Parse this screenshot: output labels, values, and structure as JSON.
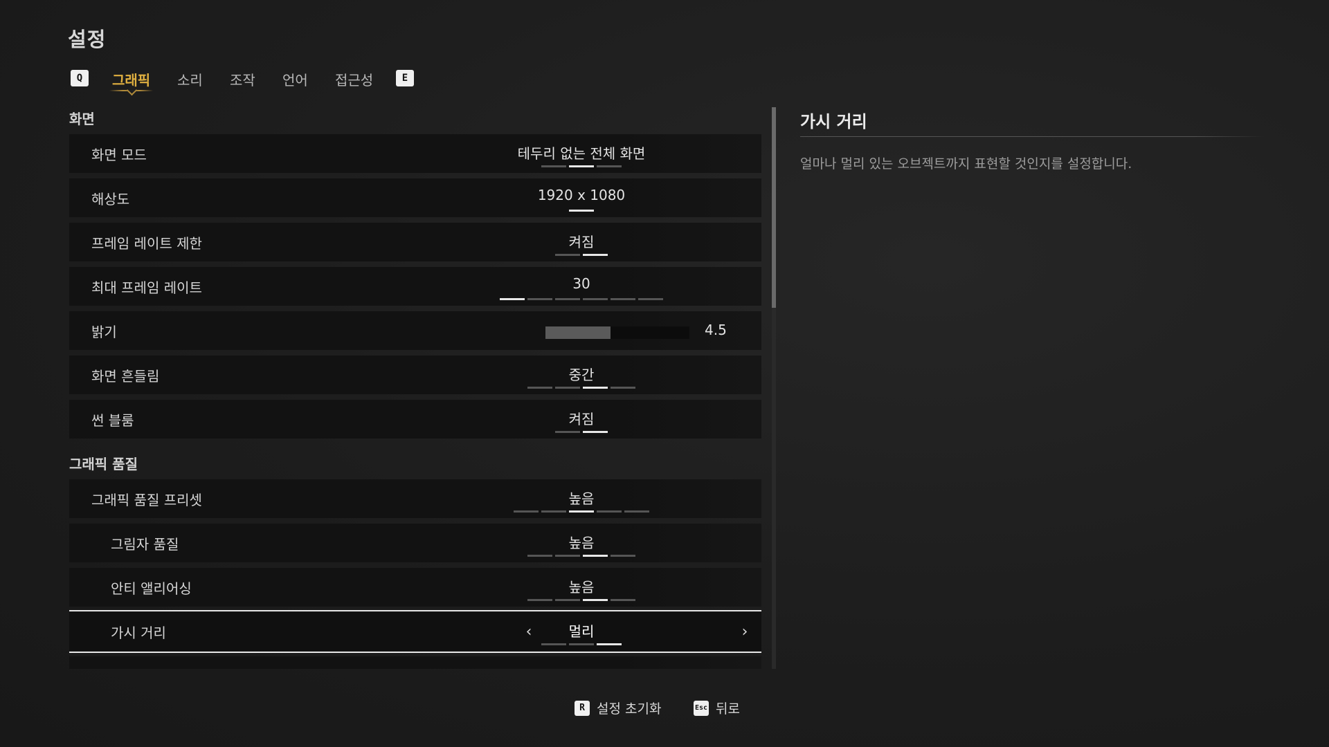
{
  "page": {
    "title": "설정"
  },
  "tabs": {
    "prev_key": "Q",
    "next_key": "E",
    "items": [
      {
        "label": "그래픽",
        "active": true
      },
      {
        "label": "소리"
      },
      {
        "label": "조작"
      },
      {
        "label": "언어"
      },
      {
        "label": "접근성"
      }
    ]
  },
  "sections": {
    "display": "화면",
    "graphics_quality": "그래픽 품질"
  },
  "rows": {
    "display_mode": {
      "label": "화면 모드",
      "value": "테두리 없는 전체 화면",
      "option_count": 3,
      "selected_index": 1
    },
    "resolution": {
      "label": "해상도",
      "value": "1920 x 1080",
      "option_count": 1,
      "selected_index": 0
    },
    "frame_limit": {
      "label": "프레임 레이트 제한",
      "value": "켜짐",
      "option_count": 2,
      "selected_index": 1
    },
    "max_fps": {
      "label": "최대 프레임 레이트",
      "value": "30",
      "option_count": 6,
      "selected_index": 0
    },
    "brightness": {
      "label": "밝기",
      "value": "4.5",
      "fill_fraction": 0.45
    },
    "screen_shake": {
      "label": "화면 흔들림",
      "value": "중간",
      "option_count": 4,
      "selected_index": 2
    },
    "sun_bloom": {
      "label": "썬 블룸",
      "value": "켜짐",
      "option_count": 2,
      "selected_index": 1
    },
    "quality_preset": {
      "label": "그래픽 품질 프리셋",
      "value": "높음",
      "option_count": 5,
      "selected_index": 2
    },
    "shadow_quality": {
      "label": "그림자 품질",
      "value": "높음",
      "option_count": 4,
      "selected_index": 2
    },
    "anti_aliasing": {
      "label": "안티 앨리어싱",
      "value": "높음",
      "option_count": 4,
      "selected_index": 2
    },
    "view_distance": {
      "label": "가시 거리",
      "value": "멀리",
      "option_count": 3,
      "selected_index": 2
    }
  },
  "detail": {
    "title": "가시 거리",
    "description": "얼마나 멀리 있는 오브젝트까지 표현할 것인지를 설정합니다."
  },
  "footer": {
    "reset_key": "R",
    "reset_label": "설정 초기화",
    "back_key": "Esc",
    "back_label": "뒤로"
  },
  "icons": {
    "arrow_left": "chevron-left-icon",
    "arrow_right": "chevron-right-icon"
  },
  "colors": {
    "accent": "#e0b040",
    "background": "#1e1e1e",
    "row": "#121212"
  }
}
